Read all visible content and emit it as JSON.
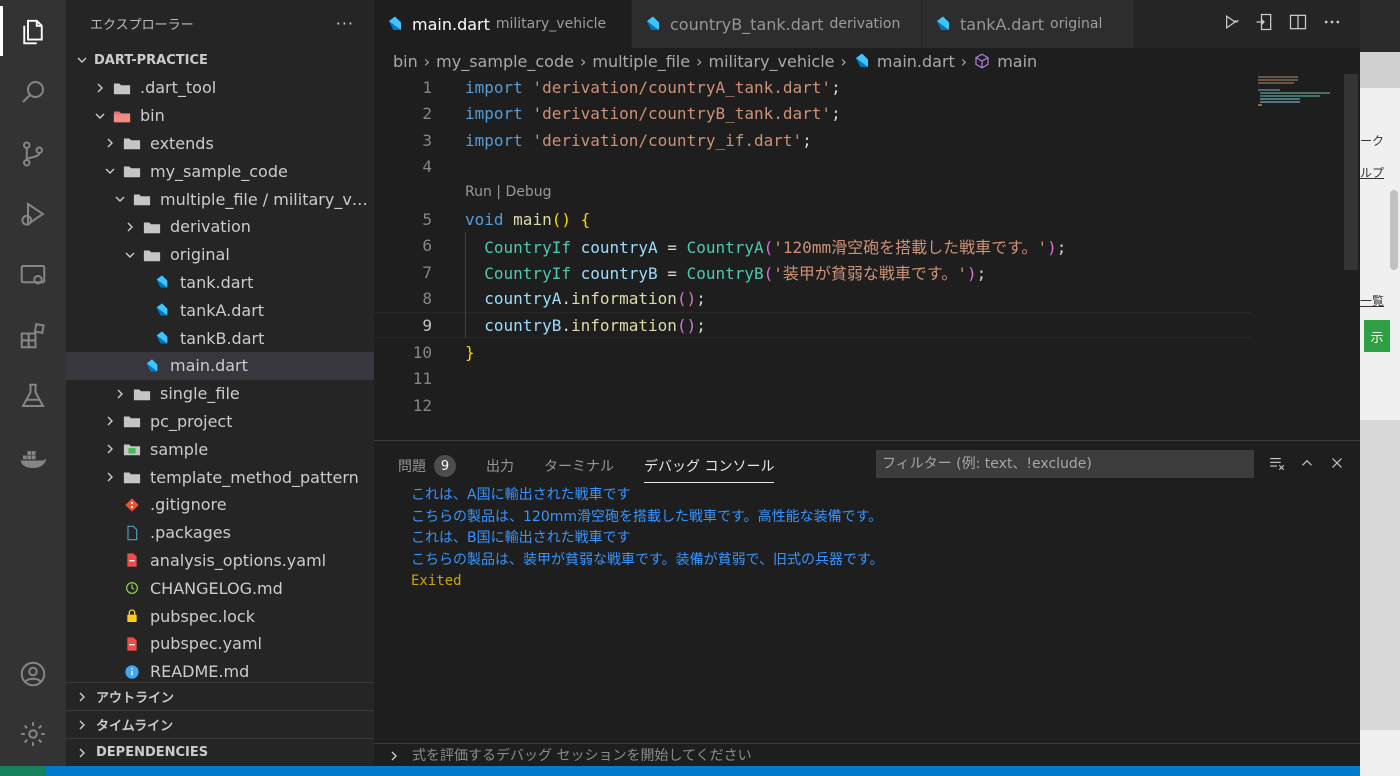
{
  "sidebar": {
    "title": "エクスプローラー",
    "more": "···",
    "project": "DART-PRACTICE",
    "tree": [
      {
        "label": ".dart_tool",
        "type": "folder",
        "expanded": false,
        "depth": 1
      },
      {
        "label": "bin",
        "type": "folder-red",
        "expanded": true,
        "depth": 1
      },
      {
        "label": "extends",
        "type": "folder",
        "expanded": false,
        "depth": 2
      },
      {
        "label": "my_sample_code",
        "type": "folder",
        "expanded": true,
        "depth": 2
      },
      {
        "label": "multiple_file / military_vehi...",
        "type": "folder",
        "expanded": true,
        "depth": 3
      },
      {
        "label": "derivation",
        "type": "folder",
        "expanded": false,
        "depth": 4
      },
      {
        "label": "original",
        "type": "folder",
        "expanded": true,
        "depth": 4
      },
      {
        "label": "tank.dart",
        "type": "dart",
        "depth": 5
      },
      {
        "label": "tankA.dart",
        "type": "dart",
        "depth": 5
      },
      {
        "label": "tankB.dart",
        "type": "dart",
        "depth": 5
      },
      {
        "label": "main.dart",
        "type": "dart",
        "depth": 4,
        "selected": true
      },
      {
        "label": "single_file",
        "type": "folder",
        "expanded": false,
        "depth": 3
      },
      {
        "label": "pc_project",
        "type": "folder",
        "expanded": false,
        "depth": 2
      },
      {
        "label": "sample",
        "type": "folder-green",
        "expanded": false,
        "depth": 2
      },
      {
        "label": "template_method_pattern",
        "type": "folder",
        "expanded": false,
        "depth": 2
      },
      {
        "label": ".gitignore",
        "type": "git",
        "depth": 2
      },
      {
        "label": ".packages",
        "type": "file",
        "depth": 2
      },
      {
        "label": "analysis_options.yaml",
        "type": "yaml",
        "depth": 2
      },
      {
        "label": "CHANGELOG.md",
        "type": "changelog",
        "depth": 2
      },
      {
        "label": "pubspec.lock",
        "type": "lock",
        "depth": 2
      },
      {
        "label": "pubspec.yaml",
        "type": "yaml",
        "depth": 2
      },
      {
        "label": "README.md",
        "type": "readme",
        "depth": 2
      }
    ],
    "sections": [
      "アウトライン",
      "タイムライン",
      "DEPENDENCIES"
    ]
  },
  "tabs": [
    {
      "label": "main.dart",
      "desc": "military_vehicle",
      "active": true
    },
    {
      "label": "countryB_tank.dart",
      "desc": "derivation",
      "active": false
    },
    {
      "label": "tankA.dart",
      "desc": "original",
      "active": false
    }
  ],
  "breadcrumb": [
    "bin",
    "my_sample_code",
    "multiple_file",
    "military_vehicle",
    "main.dart",
    "main"
  ],
  "code": {
    "line_numbers": [
      "1",
      "2",
      "3",
      "4",
      "5",
      "6",
      "7",
      "8",
      "9",
      "10",
      "11",
      "12"
    ],
    "current_line": 9,
    "codelens": {
      "run": "Run",
      "sep": " | ",
      "debug": "Debug"
    },
    "lines": [
      [
        {
          "t": "import",
          "c": "kw"
        },
        {
          "t": " ",
          "c": "pl"
        },
        {
          "t": "'derivation/countryA_tank.dart'",
          "c": "str"
        },
        {
          "t": ";",
          "c": "pl"
        }
      ],
      [
        {
          "t": "import",
          "c": "kw"
        },
        {
          "t": " ",
          "c": "pl"
        },
        {
          "t": "'derivation/countryB_tank.dart'",
          "c": "str"
        },
        {
          "t": ";",
          "c": "pl"
        }
      ],
      [
        {
          "t": "import",
          "c": "kw"
        },
        {
          "t": " ",
          "c": "pl"
        },
        {
          "t": "'derivation/country_if.dart'",
          "c": "str"
        },
        {
          "t": ";",
          "c": "pl"
        }
      ],
      [],
      [
        {
          "t": "void",
          "c": "kw"
        },
        {
          "t": " ",
          "c": "pl"
        },
        {
          "t": "main",
          "c": "fn"
        },
        {
          "t": "()",
          "c": "br1"
        },
        {
          "t": " ",
          "c": "pl"
        },
        {
          "t": "{",
          "c": "br1"
        }
      ],
      [
        {
          "t": "  ",
          "c": "pl"
        },
        {
          "t": "CountryIf",
          "c": "ty"
        },
        {
          "t": " ",
          "c": "pl"
        },
        {
          "t": "countryA",
          "c": "var"
        },
        {
          "t": " = ",
          "c": "pl"
        },
        {
          "t": "CountryA",
          "c": "ty"
        },
        {
          "t": "(",
          "c": "br2"
        },
        {
          "t": "'120mm滑空砲を搭載した戦車です。'",
          "c": "str"
        },
        {
          "t": ")",
          "c": "br2"
        },
        {
          "t": ";",
          "c": "pl"
        }
      ],
      [
        {
          "t": "  ",
          "c": "pl"
        },
        {
          "t": "CountryIf",
          "c": "ty"
        },
        {
          "t": " ",
          "c": "pl"
        },
        {
          "t": "countryB",
          "c": "var"
        },
        {
          "t": " = ",
          "c": "pl"
        },
        {
          "t": "CountryB",
          "c": "ty"
        },
        {
          "t": "(",
          "c": "br2"
        },
        {
          "t": "'装甲が貧弱な戦車です。'",
          "c": "str"
        },
        {
          "t": ")",
          "c": "br2"
        },
        {
          "t": ";",
          "c": "pl"
        }
      ],
      [
        {
          "t": "  ",
          "c": "pl"
        },
        {
          "t": "countryA",
          "c": "var"
        },
        {
          "t": ".",
          "c": "pl"
        },
        {
          "t": "information",
          "c": "fn"
        },
        {
          "t": "()",
          "c": "br2"
        },
        {
          "t": ";",
          "c": "pl"
        }
      ],
      [
        {
          "t": "  ",
          "c": "pl"
        },
        {
          "t": "countryB",
          "c": "var"
        },
        {
          "t": ".",
          "c": "pl"
        },
        {
          "t": "information",
          "c": "fn"
        },
        {
          "t": "()",
          "c": "br2"
        },
        {
          "t": ";",
          "c": "pl"
        }
      ],
      [
        {
          "t": "}",
          "c": "br1"
        }
      ],
      [],
      []
    ]
  },
  "panel": {
    "tabs": [
      {
        "label": "問題",
        "badge": "9"
      },
      {
        "label": "出力"
      },
      {
        "label": "ターミナル"
      },
      {
        "label": "デバッグ コンソール",
        "active": true
      }
    ],
    "filter_placeholder": "フィルター (例: text、!exclude)",
    "console": [
      {
        "text": "これは、A国に輸出された戦車です",
        "level": "info"
      },
      {
        "text": "こちらの製品は、120mm滑空砲を搭載した戦車です。高性能な装備です。",
        "level": "info"
      },
      {
        "text": "これは、B国に輸出された戦車です",
        "level": "info"
      },
      {
        "text": "こちらの製品は、装甲が貧弱な戦車です。装備が貧弱で、旧式の兵器です。",
        "level": "info"
      },
      {
        "text": "Exited",
        "level": "warn"
      }
    ],
    "repl_placeholder": "式を評価するデバッグ セッションを開始してください"
  },
  "background_window": {
    "label_1": "ーク",
    "label_2": "ルプ",
    "label_3": "一覧",
    "label_4": "示"
  },
  "colors": {
    "accent": "#007acc",
    "dart": "#40c4ff",
    "folder": "#c5c5c5"
  }
}
